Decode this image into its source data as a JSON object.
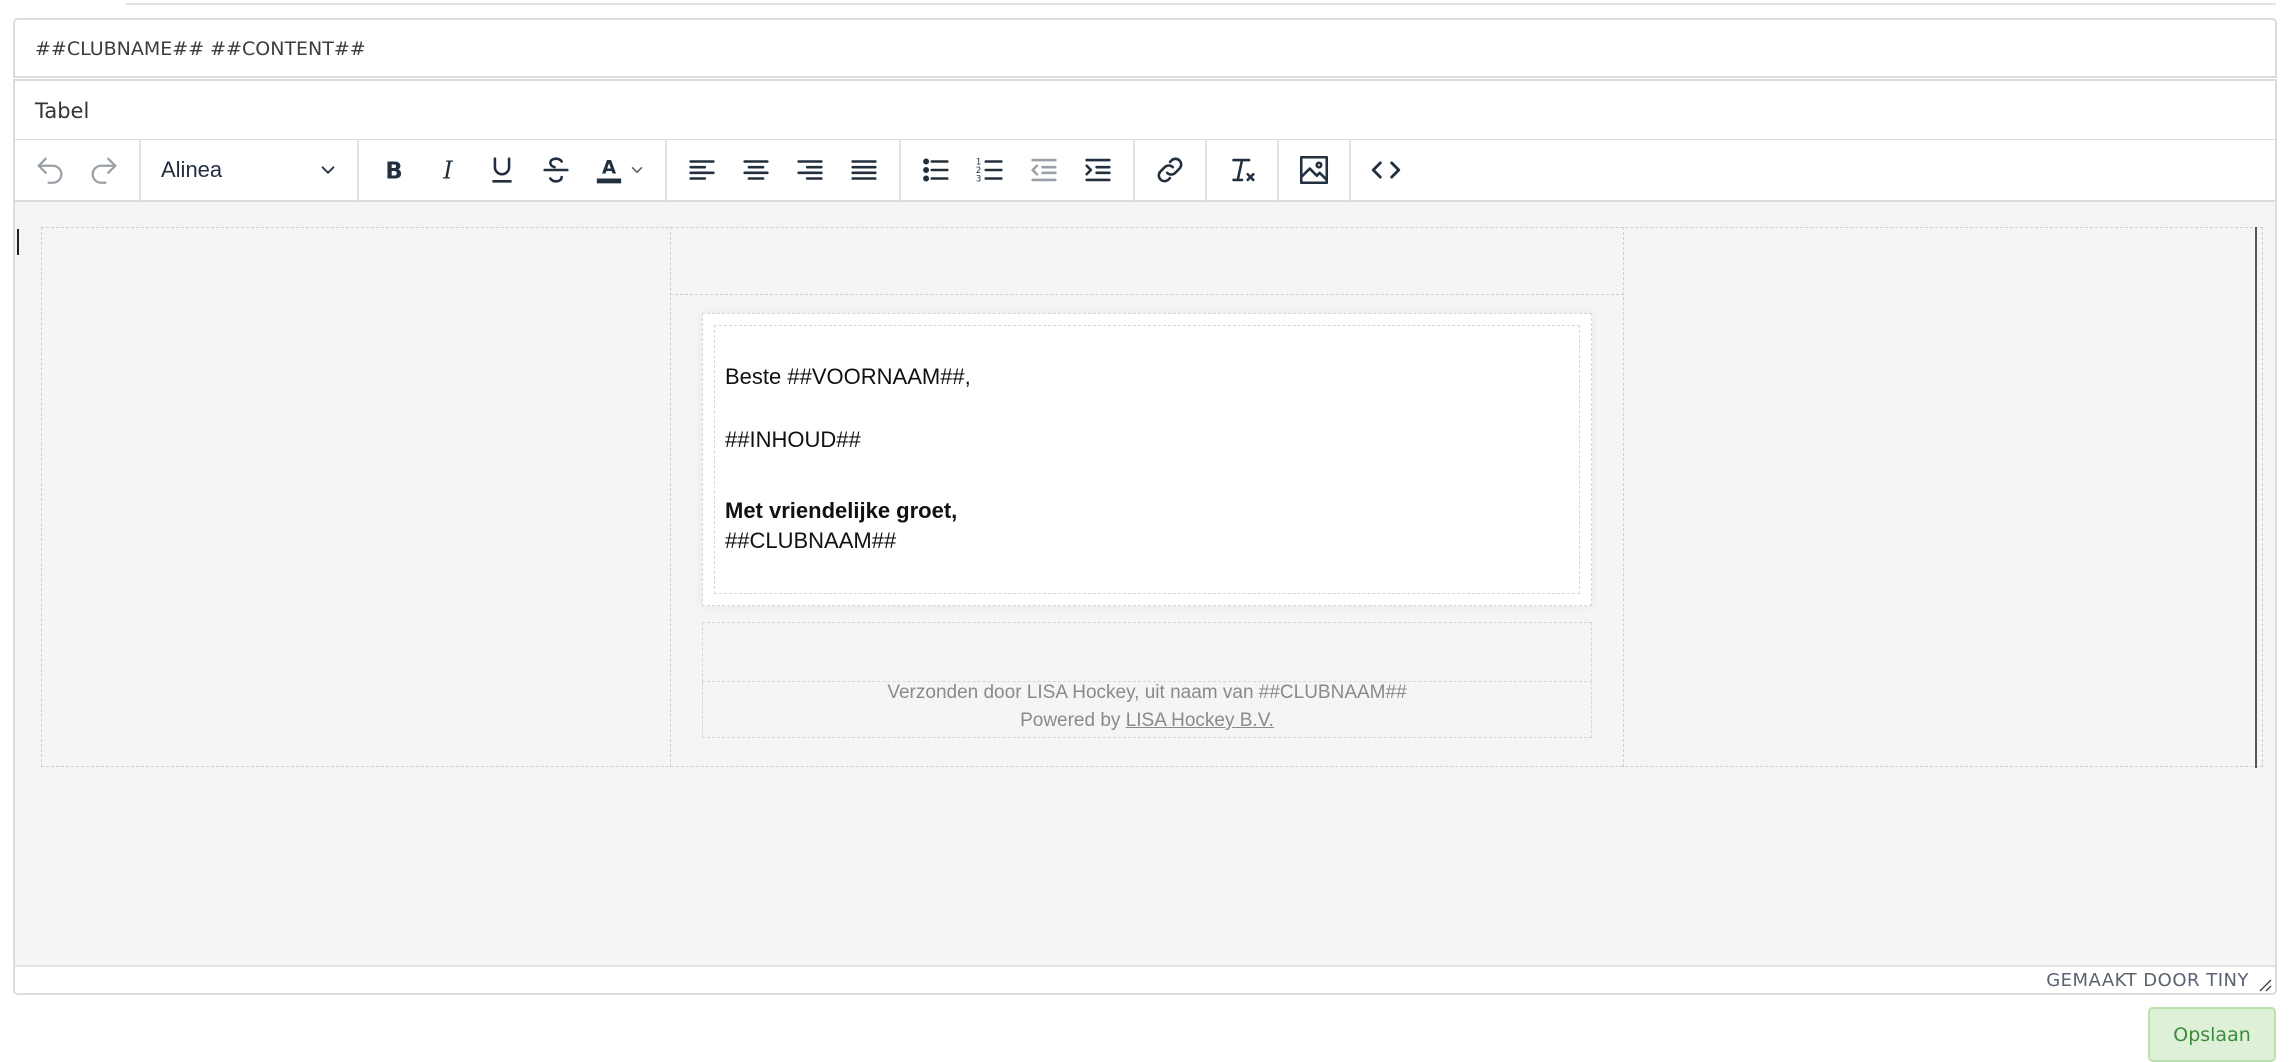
{
  "content_field": {
    "value": "##CLUBNAME## ##CONTENT##"
  },
  "title_field": {
    "value": "Tabel"
  },
  "toolbar": {
    "undo": "undo-icon",
    "redo": "redo-icon",
    "block_format": "Alinea",
    "bold": "bold-icon",
    "italic": "italic-icon",
    "underline": "underline-icon",
    "strikethrough": "strikethrough-icon",
    "text_color": "text-color-icon",
    "align_left": "align-left-icon",
    "align_center": "align-center-icon",
    "align_right": "align-right-icon",
    "align_justify": "align-justify-icon",
    "bullet_list": "bullet-list-icon",
    "numbered_list": "numbered-list-icon",
    "outdent": "outdent-icon",
    "indent": "indent-icon",
    "link": "link-icon",
    "clear_format": "clear-formatting-icon",
    "image": "image-icon",
    "source_code": "source-code-icon"
  },
  "editor": {
    "greeting": "Beste ##VOORNAAM##,",
    "content": "##INHOUD##",
    "closing": "Met vriendelijke groet,",
    "signature": "##CLUBNAAM##",
    "footer_sent": "Verzonden door LISA Hockey, uit naam van ##CLUBNAAM##",
    "footer_powered_prefix": "Powered by ",
    "footer_powered_link": "LISA Hockey B.V."
  },
  "statusbar": {
    "branding": "GEMAAKT DOOR TINY"
  },
  "actions": {
    "save": "Opslaan"
  },
  "colors": {
    "save_bg": "#dff0d8",
    "save_text": "#3c8a3c",
    "editor_bg": "#f5f5f5",
    "text_color_bar": "#222f3e"
  }
}
